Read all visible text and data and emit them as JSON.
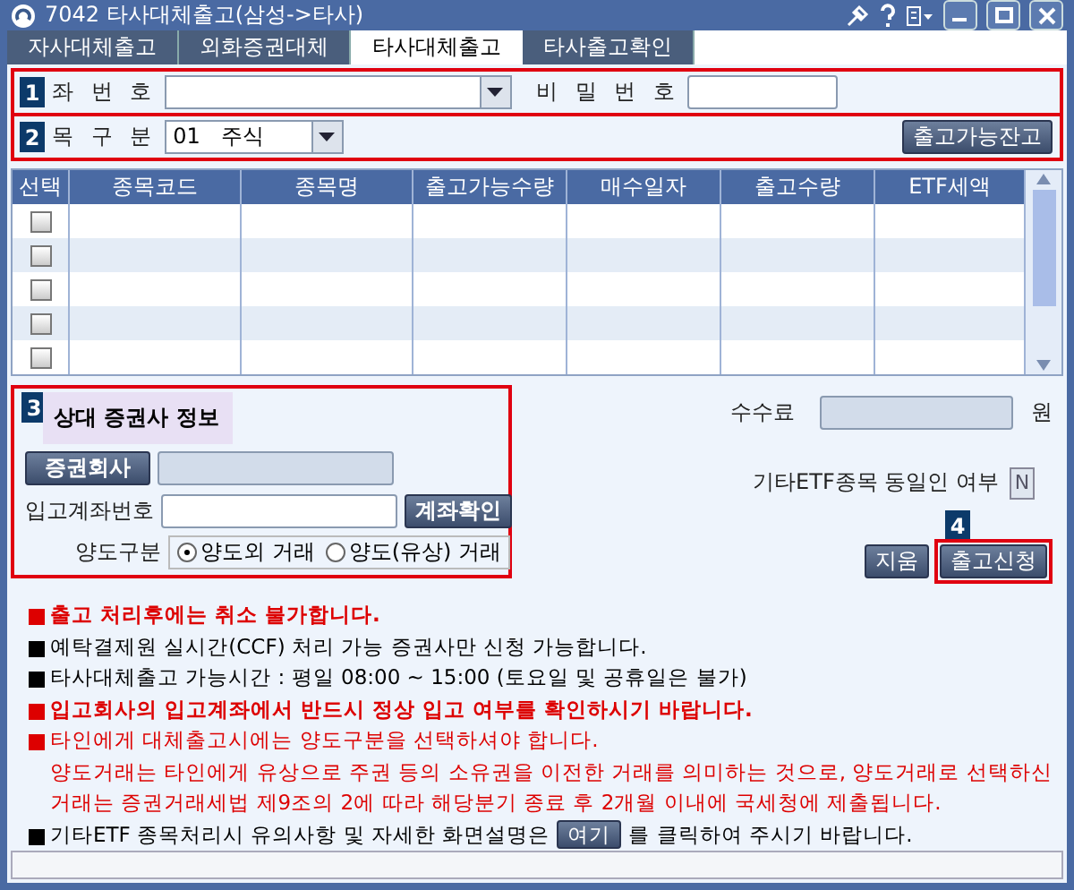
{
  "window": {
    "title": "7042 타사대체출고(삼성->타사)"
  },
  "tabs": [
    {
      "label": "자사대체출고",
      "selected": false
    },
    {
      "label": "외화증권대체",
      "selected": false
    },
    {
      "label": "타사대체출고",
      "selected": true
    },
    {
      "label": "타사출고확인",
      "selected": false
    }
  ],
  "section_1": {
    "badge": "1",
    "account_label": "좌 번 호",
    "password_label": "비 밀 번 호"
  },
  "section_2": {
    "badge": "2",
    "type_label": "목 구 분",
    "type_value": "01   주식",
    "balance_button": "출고가능잔고"
  },
  "table": {
    "columns": [
      "선택",
      "종목코드",
      "종목명",
      "출고가능수량",
      "매수일자",
      "출고수량",
      "ETF세액"
    ],
    "rows": [
      {
        "checked": false
      },
      {
        "checked": false
      },
      {
        "checked": false
      },
      {
        "checked": false
      },
      {
        "checked": false
      }
    ]
  },
  "section_3": {
    "badge": "3",
    "title": "상대 증권사 정보",
    "company_button": "증권회사",
    "account_label": "입고계좌번호",
    "confirm_button": "계좌확인",
    "transfer_label": "양도구분",
    "transfer_options": [
      {
        "label": "양도외 거래",
        "selected": true
      },
      {
        "label": "양도(유상) 거래",
        "selected": false
      }
    ]
  },
  "fee": {
    "label": "수수료",
    "unit": "원"
  },
  "etf_same_owner": {
    "label": "기타ETF종목 동일인 여부",
    "value": "N"
  },
  "actions": {
    "badge": "4",
    "clear_button": "지움",
    "submit_button": "출고신청"
  },
  "notes": [
    {
      "kind": "plain",
      "color": "#dd0000",
      "bold": true,
      "lines": [
        "출고 처리후에는 취소 불가합니다."
      ]
    },
    {
      "kind": "plain",
      "color": "#000000",
      "bold": false,
      "lines": [
        "예탁결제원 실시간(CCF) 처리 가능 증권사만 신청 가능합니다."
      ]
    },
    {
      "kind": "plain",
      "color": "#000000",
      "bold": false,
      "lines": [
        "타사대체출고 가능시간 : 평일 08:00 ~ 15:00  (토요일 및 공휴일은 불가)"
      ]
    },
    {
      "kind": "plain",
      "color": "#dd0000",
      "bold": true,
      "lines": [
        "입고회사의 입고계좌에서 반드시 정상 입고 여부를 확인하시기 바랍니다."
      ]
    },
    {
      "kind": "plain",
      "color": "#dd0000",
      "bold": false,
      "lines": [
        "타인에게 대체출고시에는 양도구분을 선택하셔야 합니다.",
        "양도거래는 타인에게 유상으로 주권 등의 소유권을 이전한 거래를 의미하는 것으로, 양도거래로 선택하신",
        "거래는 증권거래세법 제9조의 2에 따라 해당분기 종료 후 2개월 이내에 국세청에 제출됩니다."
      ]
    },
    {
      "kind": "link",
      "color": "#000000",
      "before": "기타ETF 종목처리시 유의사항 및 자세한 화면설명은",
      "link": "여기",
      "after": "를 클릭하여 주시기 바랍니다."
    }
  ]
}
